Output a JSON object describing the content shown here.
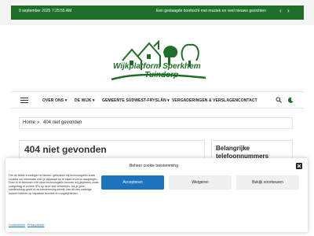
{
  "topbar": {
    "date": "9 september 2025",
    "time": "7:25:55 AM",
    "ticker": "Een geslaagde boottocht met muziek en veel nieuwe gezichten",
    "prev_label": "‹",
    "next_label": "›"
  },
  "logo": {
    "line1": "Wijkplatform Sperkhem",
    "line2": "- Tuindorp"
  },
  "nav": {
    "items": [
      {
        "label": "OVER ONS",
        "has_submenu": true
      },
      {
        "label": "DE WIJK",
        "has_submenu": true
      },
      {
        "label": "GEMEENTE SÚDWEST-FRYSLÂN",
        "has_submenu": true
      },
      {
        "label": "VERGADERINGEN & VERSLAGEN",
        "has_submenu": false
      },
      {
        "label": "CONTACT",
        "has_submenu": false
      }
    ],
    "submenu_icon": "chevron-down-icon",
    "search_icon": "search-icon",
    "theme_icon": "moon-icon"
  },
  "breadcrumb": {
    "home": "Home",
    "separator": "»",
    "current": "404 niet gevonden"
  },
  "main": {
    "heading": "404 niet gevonden"
  },
  "sidebar": {
    "title": "Belangrijke telefoonnummers"
  },
  "cookie": {
    "title": "Beheer cookie toestemming",
    "body": "Om de beste ervaringen te bieden, gebruiken wij technologieën zoals cookies om informatie over je apparaat op te slaan en/of te raadplegen. Door in te stemmen met deze technologieën kunnen wij gegevens zoals surfgedrag of unieke ID's op deze site verwerken. Als je geen toestemming geeft of uw toestemming intrekt, kan dit een nadelige invloed hebben op bepaalde functies en mogelijkheden.",
    "accept": "Accepteren",
    "deny": "Weigeren",
    "preferences": "Bekijk voorkeuren",
    "link_cookie": "Cookiebeleid",
    "link_privacy": "Privacybeleid"
  },
  "colors": {
    "brand_green": "#1e6f27",
    "accept_blue": "#1e73be"
  }
}
